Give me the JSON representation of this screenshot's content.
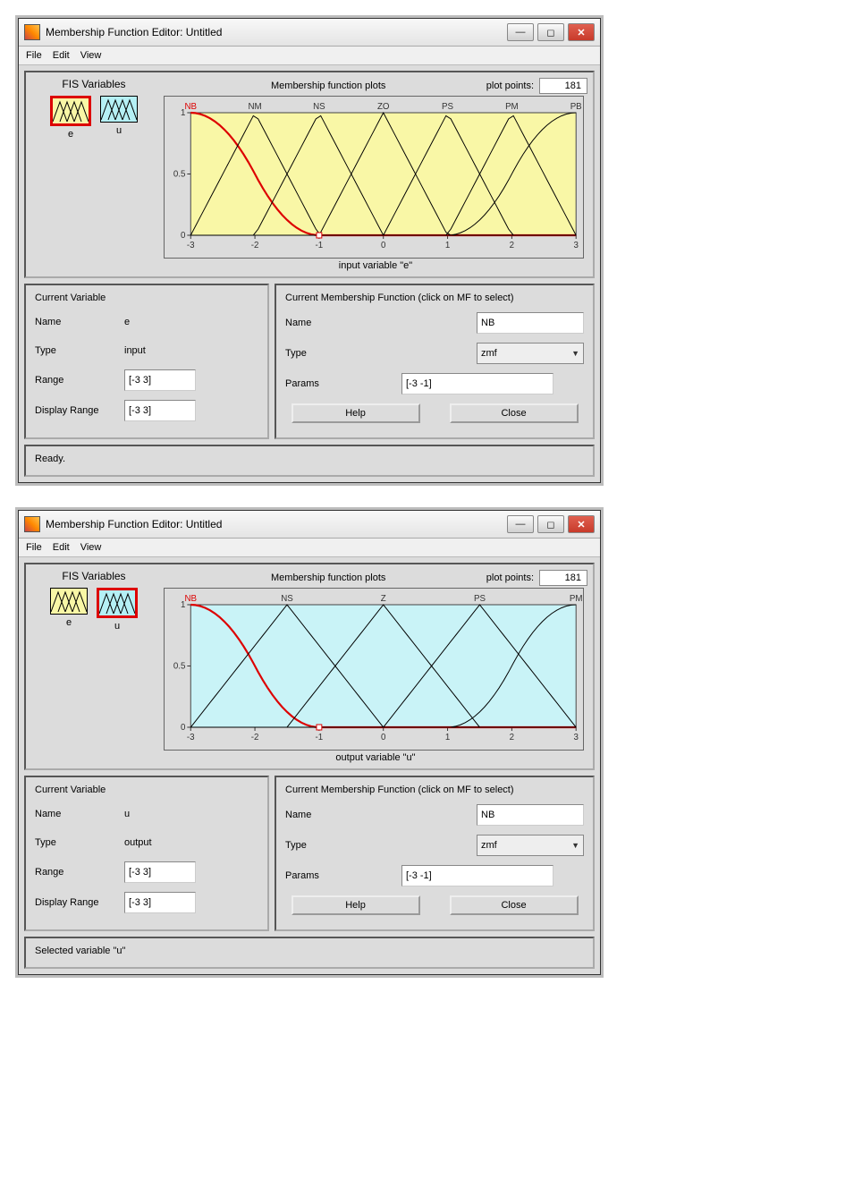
{
  "windows": [
    {
      "title": "Membership Function Editor: Untitled",
      "menu": [
        "File",
        "Edit",
        "View"
      ],
      "fis_title": "FIS Variables",
      "fis_vars": [
        {
          "name": "e",
          "color": "#f9f7a6",
          "selected": true
        },
        {
          "name": "u",
          "color": "#b5f0f5",
          "selected": false
        }
      ],
      "plot_header_label": "Membership function plots",
      "plot_points_label": "plot points:",
      "plot_points_value": "181",
      "plot_bg": "#f9f7a6",
      "axis_label": "input variable \"e\"",
      "mf_labels": [
        "NB",
        "NM",
        "NS",
        "ZO",
        "PS",
        "PM",
        "PB"
      ],
      "current_var": {
        "title": "Current Variable",
        "name_label": "Name",
        "name_value": "e",
        "type_label": "Type",
        "type_value": "input",
        "range_label": "Range",
        "range_value": "[-3 3]",
        "display_range_label": "Display Range",
        "display_range_value": "[-3 3]"
      },
      "current_mf": {
        "title": "Current Membership Function (click on MF to select)",
        "name_label": "Name",
        "name_value": "NB",
        "type_label": "Type",
        "type_value": "zmf",
        "params_label": "Params",
        "params_value": "[-3 -1]",
        "help_label": "Help",
        "close_label": "Close"
      },
      "status": "Ready.",
      "chart_data": {
        "type": "line",
        "xlabel": "input variable \"e\"",
        "ylabel": "",
        "xlim": [
          -3,
          3
        ],
        "ylim": [
          0,
          1
        ],
        "xticks": [
          -3,
          -2,
          -1,
          0,
          1,
          2,
          3
        ],
        "yticks": [
          0,
          0.5,
          1
        ],
        "series": [
          {
            "name": "NB",
            "type": "zmf",
            "params": [
              -3,
              -1
            ],
            "selected": true,
            "color": "#d00"
          },
          {
            "name": "NM",
            "type": "trimf",
            "params": [
              -3,
              -2,
              -1
            ],
            "color": "#000"
          },
          {
            "name": "NS",
            "type": "trimf",
            "params": [
              -2,
              -1,
              0
            ],
            "color": "#000"
          },
          {
            "name": "ZO",
            "type": "trimf",
            "params": [
              -1,
              0,
              1
            ],
            "color": "#000"
          },
          {
            "name": "PS",
            "type": "trimf",
            "params": [
              0,
              1,
              2
            ],
            "color": "#000"
          },
          {
            "name": "PM",
            "type": "trimf",
            "params": [
              1,
              2,
              3
            ],
            "color": "#000"
          },
          {
            "name": "PB",
            "type": "smf",
            "params": [
              1,
              3
            ],
            "color": "#000"
          }
        ]
      }
    },
    {
      "title": "Membership Function Editor: Untitled",
      "menu": [
        "File",
        "Edit",
        "View"
      ],
      "fis_title": "FIS Variables",
      "fis_vars": [
        {
          "name": "e",
          "color": "#f9f7a6",
          "selected": false
        },
        {
          "name": "u",
          "color": "#b5f0f5",
          "selected": true
        }
      ],
      "plot_header_label": "Membership function plots",
      "plot_points_label": "plot points:",
      "plot_points_value": "181",
      "plot_bg": "#c9f3f7",
      "axis_label": "output variable \"u\"",
      "mf_labels": [
        "NB",
        "NS",
        "Z",
        "PS",
        "PM"
      ],
      "current_var": {
        "title": "Current Variable",
        "name_label": "Name",
        "name_value": "u",
        "type_label": "Type",
        "type_value": "output",
        "range_label": "Range",
        "range_value": "[-3 3]",
        "display_range_label": "Display Range",
        "display_range_value": "[-3 3]"
      },
      "current_mf": {
        "title": "Current Membership Function (click on MF to select)",
        "name_label": "Name",
        "name_value": "NB",
        "type_label": "Type",
        "type_value": "zmf",
        "params_label": "Params",
        "params_value": "[-3 -1]",
        "help_label": "Help",
        "close_label": "Close"
      },
      "status": "Selected variable \"u\"",
      "chart_data": {
        "type": "line",
        "xlabel": "output variable \"u\"",
        "ylabel": "",
        "xlim": [
          -3,
          3
        ],
        "ylim": [
          0,
          1
        ],
        "xticks": [
          -3,
          -2,
          -1,
          0,
          1,
          2,
          3
        ],
        "yticks": [
          0,
          0.5,
          1
        ],
        "series": [
          {
            "name": "NB",
            "type": "zmf",
            "params": [
              -3,
              -1
            ],
            "selected": true,
            "color": "#d00"
          },
          {
            "name": "NS",
            "type": "trimf",
            "params": [
              -3,
              -1.5,
              0
            ],
            "color": "#000"
          },
          {
            "name": "Z",
            "type": "trimf",
            "params": [
              -1.5,
              0,
              1.5
            ],
            "color": "#000"
          },
          {
            "name": "PS",
            "type": "trimf",
            "params": [
              0,
              1.5,
              3
            ],
            "color": "#000"
          },
          {
            "name": "PM",
            "type": "smf",
            "params": [
              1,
              3
            ],
            "color": "#000"
          }
        ]
      }
    }
  ]
}
